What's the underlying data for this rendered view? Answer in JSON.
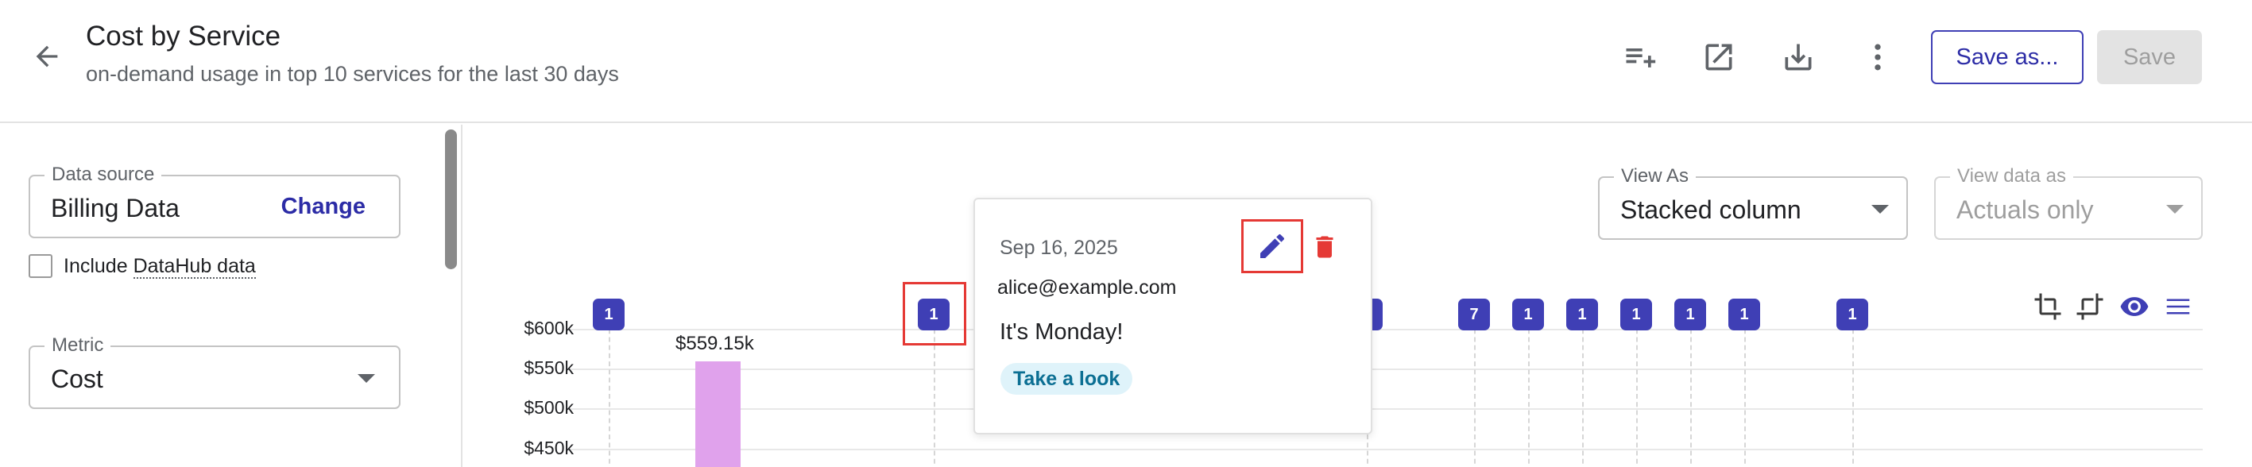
{
  "header": {
    "title": "Cost by Service",
    "subtitle": "on-demand usage in top 10 services for the last 30 days",
    "save_as_label": "Save as...",
    "save_label": "Save"
  },
  "sidebar": {
    "data_source": {
      "label": "Data source",
      "value": "Billing Data",
      "change_label": "Change"
    },
    "include_checkbox": {
      "label_prefix": "Include ",
      "label_link": "DataHub data",
      "checked": false
    },
    "metric": {
      "label": "Metric",
      "value": "Cost"
    }
  },
  "view_controls": {
    "view_as": {
      "label": "View As",
      "value": "Stacked column"
    },
    "view_data_as": {
      "label": "View data as",
      "value": "Actuals only",
      "disabled": true
    }
  },
  "chart": {
    "y_ticks": [
      "$600k",
      "$550k",
      "$500k",
      "$450k"
    ],
    "bar_labels": [
      "$559.15k"
    ],
    "annotation_markers": [
      "1",
      "1",
      "1",
      "7",
      "1",
      "1",
      "1",
      "1",
      "1",
      "1"
    ]
  },
  "chart_data": {
    "type": "bar",
    "title": "",
    "ylabel": "",
    "y_ticks": [
      "$450k",
      "$500k",
      "$550k",
      "$600k"
    ],
    "series": [
      {
        "values": [
          559.15
        ]
      }
    ],
    "data_labels": [
      "$559.15k"
    ],
    "annotations": [
      {
        "count": 1
      },
      {
        "count": 1
      },
      {
        "count": 1
      },
      {
        "count": 7
      },
      {
        "count": 1
      },
      {
        "count": 1
      },
      {
        "count": 1
      },
      {
        "count": 1
      },
      {
        "count": 1
      },
      {
        "count": 1
      }
    ],
    "grid": true
  },
  "popover": {
    "date": "Sep 16, 2025",
    "email": "alice@example.com",
    "message": "It's Monday!",
    "chip": "Take a look"
  },
  "colors": {
    "accent": "#3f3fb5",
    "bar": "#e0a2ec",
    "delete": "#e53935",
    "highlight_box": "#e53935",
    "chip_bg": "#dff3fa"
  },
  "icons": [
    "back-arrow-icon",
    "add-to-dashboard-icon",
    "open-in-new-icon",
    "download-icon",
    "more-vert-icon",
    "crop-icon",
    "crop-rotate-icon",
    "eye-icon",
    "list-icon",
    "pencil-icon",
    "trash-icon"
  ]
}
